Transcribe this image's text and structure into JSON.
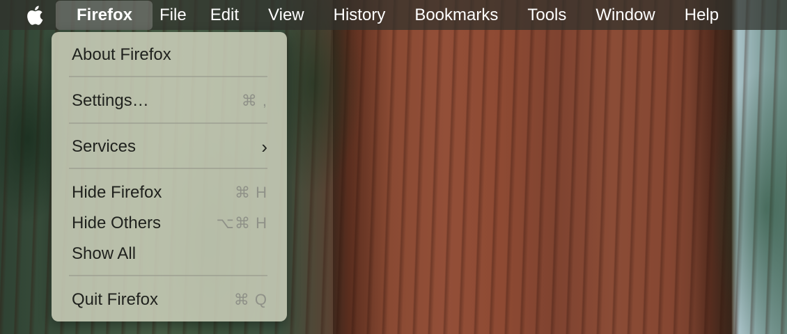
{
  "menubar": {
    "app_name": "Firefox",
    "items": [
      "File",
      "Edit",
      "View",
      "History",
      "Bookmarks",
      "Tools",
      "Window",
      "Help"
    ]
  },
  "dropdown": {
    "about": "About Firefox",
    "settings": {
      "label": "Settings…",
      "shortcut": "⌘ ,"
    },
    "services": {
      "label": "Services",
      "submenu": "›"
    },
    "hide": {
      "label": "Hide Firefox",
      "shortcut": "⌘ H"
    },
    "hide_others": {
      "label": "Hide Others",
      "shortcut": "⌥⌘ H"
    },
    "show_all": {
      "label": "Show All"
    },
    "quit": {
      "label": "Quit Firefox",
      "shortcut": "⌘ Q"
    }
  }
}
